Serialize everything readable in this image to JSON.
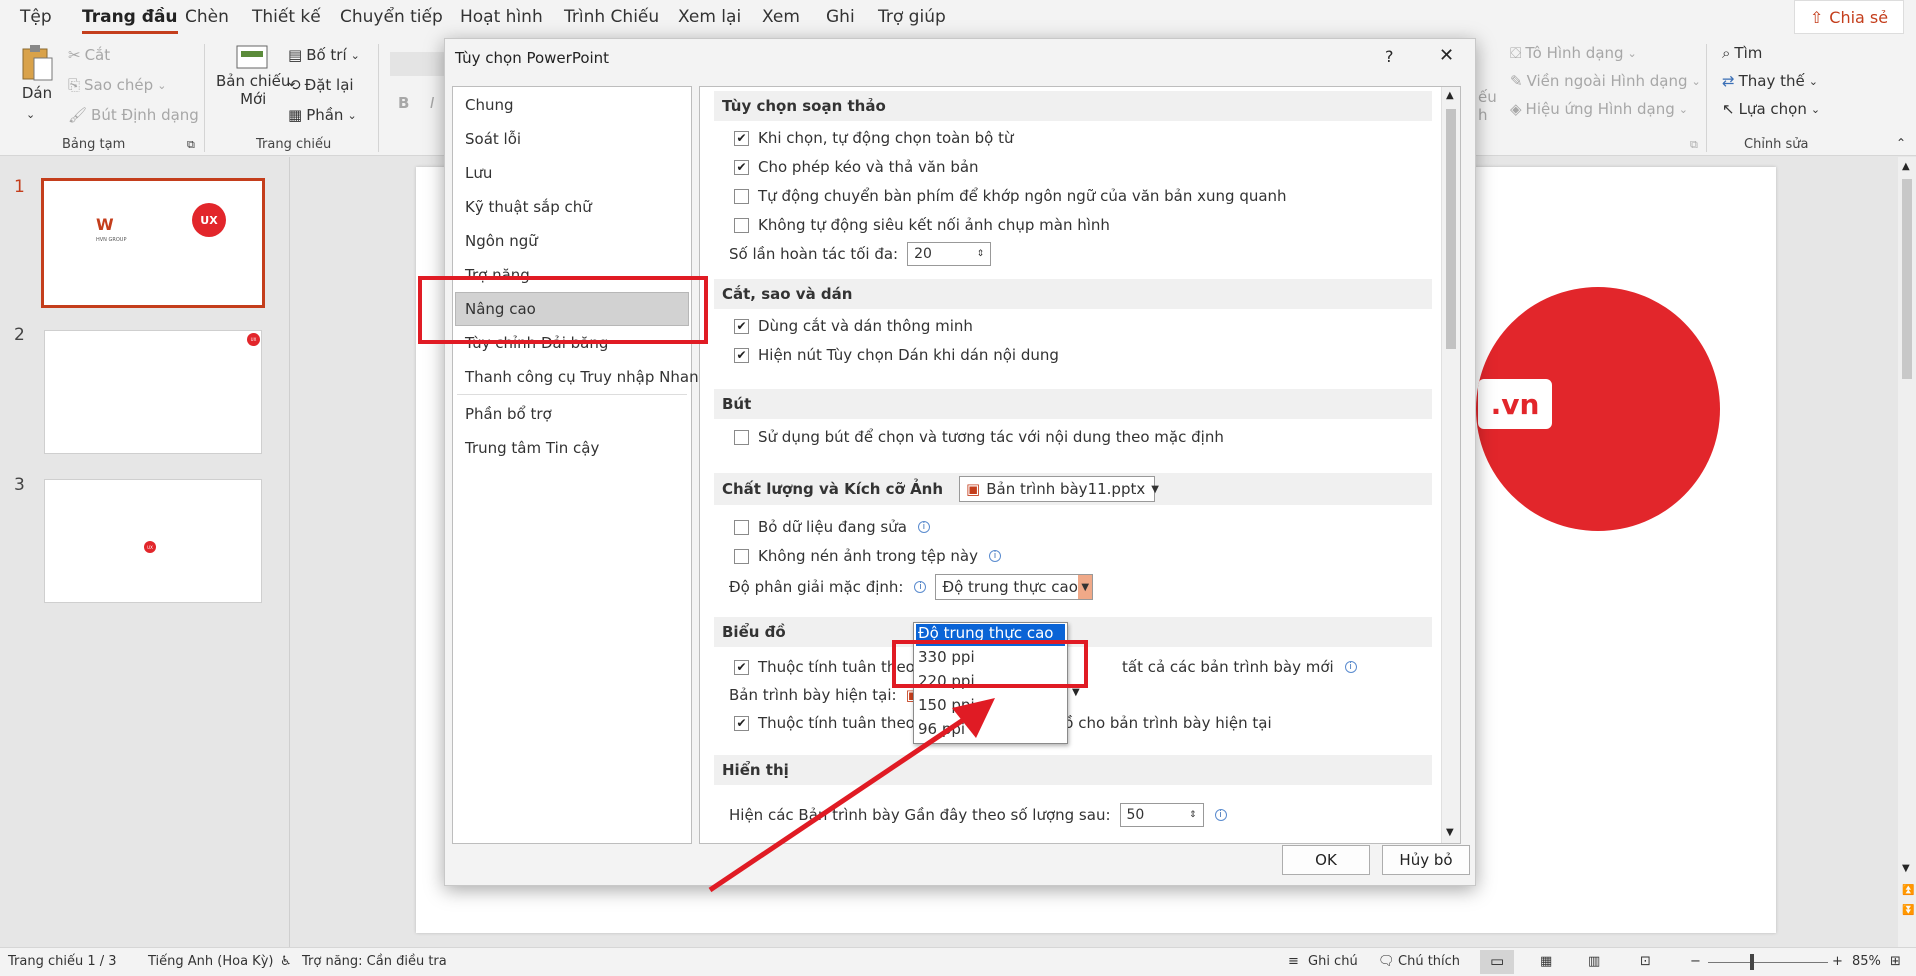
{
  "menubar": {
    "items": [
      "Tệp",
      "Trang đầu",
      "Chèn",
      "Thiết kế",
      "Chuyển tiếp",
      "Hoạt hình",
      "Trình Chiếu",
      "Xem lại",
      "Xem",
      "Ghi",
      "Trợ giúp"
    ],
    "active": "Trang đầu",
    "share_label": "Chia sẻ"
  },
  "ribbon": {
    "clipboard": {
      "paste": "Dán",
      "cut": "Cắt",
      "copy": "Sao chép",
      "format_painter": "Bút Định dạng",
      "group": "Bảng tạm"
    },
    "slides": {
      "new_slide_line1": "Bản chiếu",
      "new_slide_line2": "Mới",
      "layout": "Bố trí",
      "reset": "Đặt lại",
      "section": "Phần",
      "group": "Trang chiếu"
    },
    "font": {
      "bold": "B",
      "italic": "I"
    },
    "shapes": {
      "fill": "Tô Hình dạng",
      "outline": "Viền ngoài Hình dạng",
      "effects": "Hiệu ứng Hình dạng",
      "cut_text1": "ếu",
      "cut_text2": "h"
    },
    "editing": {
      "find": "Tìm",
      "replace": "Thay thế",
      "select": "Lựa chọn",
      "group": "Chỉnh sửa"
    }
  },
  "slides": [
    {
      "number": "1",
      "logo_text": "UX",
      "brand": "HVN GROUP"
    },
    {
      "number": "2",
      "logo_text": "UX"
    },
    {
      "number": "3",
      "logo_text": "UX"
    }
  ],
  "canvas": {
    "logo_text": ".vn"
  },
  "dialog": {
    "title": "Tùy chọn PowerPoint",
    "help": "?",
    "close": "✕",
    "nav": [
      "Chung",
      "Soát lỗi",
      "Lưu",
      "Kỹ thuật sắp chữ",
      "Ngôn ngữ",
      "Trợ năng",
      "Nâng cao",
      "Tùy chỉnh Dải băng",
      "Thanh công cụ Truy nhập Nhanh",
      "Phần bổ trợ",
      "Trung tâm Tin cậy"
    ],
    "selected_nav": "Nâng cao",
    "sections": {
      "editing": {
        "title": "Tùy chọn soạn thảo",
        "opt1": "Khi chọn, tự động chọn toàn bộ từ",
        "opt2": "Cho phép kéo và thả văn bản",
        "opt3": "Tự động chuyển bàn phím để khớp ngôn ngữ của văn bản xung quanh",
        "opt4": "Không tự động siêu kết nối ảnh chụp màn hình",
        "undo_label": "Số lần hoàn tác tối đa:",
        "undo_value": "20"
      },
      "cutpaste": {
        "title": "Cắt, sao và dán",
        "opt1": "Dùng cắt và dán thông minh",
        "opt2": "Hiện nút Tùy chọn Dán khi dán nội dung"
      },
      "pen": {
        "title": "Bút",
        "opt1": "Sử dụng bút để chọn và tương tác với nội dung theo mặc định"
      },
      "image": {
        "title": "Chất lượng và Kích cỡ Ảnh",
        "file": "Bản trình bày11.pptx",
        "opt1": "Bỏ dữ liệu đang sửa",
        "opt2": "Không nén ảnh trong tệp này",
        "resolution_label": "Độ phân giải mặc định:",
        "resolution_value": "Độ trung thực cao"
      },
      "chart": {
        "title": "Biểu đồ",
        "opt1_a": "Thuộc tính tuân theo điể",
        "opt1_b": "tất cả các bản trình bày mới",
        "current_label": "Bản trình bày hiện tại:",
        "opt2": "Thuộc tính tuân theo điểm dữ liệu biểu đồ cho bản trình bày hiện tại"
      },
      "display": {
        "title": "Hiển thị",
        "recent_label": "Hiện các Bản trình bày Gần đây theo số lượng sau:",
        "recent_value": "50"
      }
    },
    "dropdown_options": [
      "Độ trung thực cao",
      "330 ppi",
      "220 ppi",
      "150 ppi",
      "96 ppi"
    ],
    "ok": "OK",
    "cancel": "Hủy bỏ"
  },
  "statusbar": {
    "slide_info": "Trang chiếu 1 / 3",
    "language": "Tiếng Anh (Hoa Kỳ)",
    "accessibility": "Trợ năng: Cần điều tra",
    "notes": "Ghi chú",
    "comments": "Chú thích",
    "zoom": "85%"
  },
  "colors": {
    "accent": "#c43e1c",
    "highlight": "#e01b24",
    "selection": "#0a64d6"
  }
}
